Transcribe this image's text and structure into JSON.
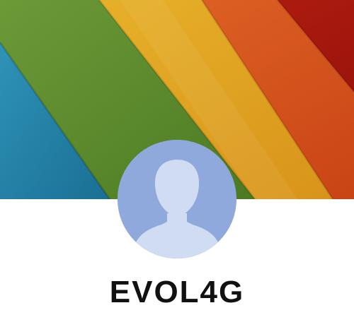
{
  "profile": {
    "username": "EVOL4G",
    "avatar_icon": "default-user-silhouette-icon",
    "cover_image": "colored-paper-stripes"
  },
  "colors": {
    "avatar_bg": "#8fa9dc",
    "avatar_figure": "#d0dcf1",
    "stripes": [
      "#1d7fa6",
      "#5b8c2c",
      "#e3a81f",
      "#d8531f",
      "#b3180f"
    ]
  }
}
